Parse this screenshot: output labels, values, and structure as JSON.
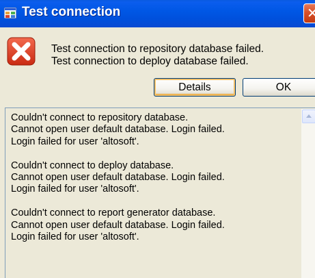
{
  "window": {
    "title": "Test connection"
  },
  "messages": [
    "Test connection to repository database failed.",
    "Test connection to deploy database failed."
  ],
  "buttons": {
    "details_label": "Details",
    "ok_label": "OK"
  },
  "details": {
    "text": "Couldn't connect to repository database.\nCannot open user default database. Login failed.\nLogin failed for user 'altosoft'.\n\nCouldn't connect to deploy database.\nCannot open user default database. Login failed.\nLogin failed for user 'altosoft'.\n\nCouldn't connect to report generator database.\nCannot open user default database. Login failed.\nLogin failed for user 'altosoft'."
  },
  "icons": {
    "title": "app-window-icon",
    "close": "close-icon",
    "error": "error-icon",
    "scroll_up": "scroll-up-arrow-icon"
  },
  "colors": {
    "titlebar": "#0054e3",
    "error_red": "#e03a1e",
    "dialog_bg": "#ece9d8"
  }
}
